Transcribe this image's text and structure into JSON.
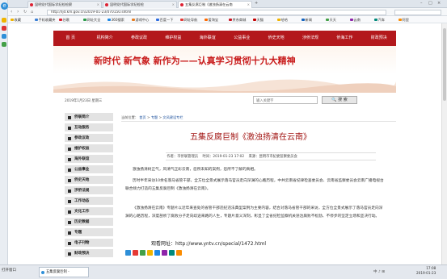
{
  "browser": {
    "tabs": [
      {
        "label": "昆明党代国际学纪检检察",
        "active": false
      },
      {
        "label": "昆明党代国际学纪检检",
        "active": false
      },
      {
        "label": "五集反腐巨制《激浊扬清在云南",
        "active": true
      }
    ],
    "address": "http://ljd.km.gov.cn/2019-01-23/070150.shtml",
    "bookmarks": [
      {
        "label": "收藏",
        "color": "#f0b400"
      },
      {
        "label": "手机收藏夹",
        "color": "#3a7fd5"
      },
      {
        "label": "谷歌",
        "color": "#d23"
      },
      {
        "label": "网址大全",
        "color": "#2a9d4a"
      },
      {
        "label": "360搜索",
        "color": "#1e88e5"
      },
      {
        "label": "游戏中心",
        "color": "#e67e22"
      },
      {
        "label": "百度一下",
        "color": "#2d6cdf"
      },
      {
        "label": "网址导航",
        "color": "#e53935"
      },
      {
        "label": "爱淘宝",
        "color": "#ff6a00"
      },
      {
        "label": "京东商城",
        "color": "#c91623"
      },
      {
        "label": "天猫",
        "color": "#c40000"
      },
      {
        "label": "哈哈",
        "color": "#f0b400"
      },
      {
        "label": "新闻",
        "color": "#1565c0"
      },
      {
        "label": "天天",
        "color": "#43a047"
      },
      {
        "label": "云南",
        "color": "#8e24aa"
      },
      {
        "label": "汽车",
        "color": "#00897b"
      },
      {
        "label": "阿里",
        "color": "#fb8c00"
      }
    ]
  },
  "site": {
    "nav": [
      {
        "label": "首 页",
        "active": false
      },
      {
        "label": "机构简介",
        "active": false
      },
      {
        "label": "参政议政",
        "active": false
      },
      {
        "label": "维护权益",
        "active": false
      },
      {
        "label": "海外联谊",
        "active": false
      },
      {
        "label": "公益事业",
        "active": false
      },
      {
        "label": "侨史天地",
        "active": false
      },
      {
        "label": "涉侨法规",
        "active": false
      },
      {
        "label": "侨海工作",
        "active": false
      },
      {
        "label": "财政预决",
        "active": false
      }
    ],
    "slogan": "新时代 新气象 新作为——认真学习贯彻十九大精神",
    "date": "2019年1月23日 星期三",
    "search_placeholder": "输入关键字",
    "search_button": "搜 索",
    "sidebar": [
      "侨联简介",
      "互动服务",
      "参政议政",
      "维护权益",
      "海外联谊",
      "公益事业",
      "侨史天地",
      "涉侨法规",
      "工作动态",
      "文化工作",
      "历史数据",
      "专题",
      "电子刊物",
      "财政预决"
    ],
    "breadcrumb": [
      "当前位置：",
      "首页",
      "专题",
      "文风建设专栏"
    ],
    "article": {
      "title": "五集反腐巨制《激浊扬清在云南》",
      "author_label": "作者：",
      "author": "市侨联管理员",
      "time_label": "时间：",
      "time": "2019-01-23 17:02",
      "source_label": "来源：",
      "source": "昆明市市纪委监察委员会",
      "paragraphs": [
        "激浊扬清树正气，风清气正彩云南，您所未知的案例，您所不了解的真相。",
        "历时半年采访10余名落马省管干部，全方位全景式展示落马官员走向深渊的心路历程，中共云南省纪律检查委员会、云南省监察委员会云南广播电视台联合倾力打造的五集反腐巨制《激浊扬清在云南》。",
        "《激浊扬清在云南》专题片以近年来查处的省管干部违纪违法典型案例为主要内容，结合对落马省管干部的采访，全方位全景式展示了落马官员走向深渊的心路历程，深度剖析了腐败分子走向歧途来路的人生，专题片意义深刻，彰显了全省纪检监察机关惩治腐败不松劲、不停步的坚定立场和坚决行动。"
      ],
      "watch_label": "观看网址：",
      "watch_url": "http://www.yntv.cn/special/1472.html"
    }
  },
  "taskbar": {
    "start": "打开窗口",
    "task_label": "五集反腐巨制 -",
    "tray": "中 ♪ ⊞",
    "time": "17:08",
    "date": "2019-01-23"
  }
}
